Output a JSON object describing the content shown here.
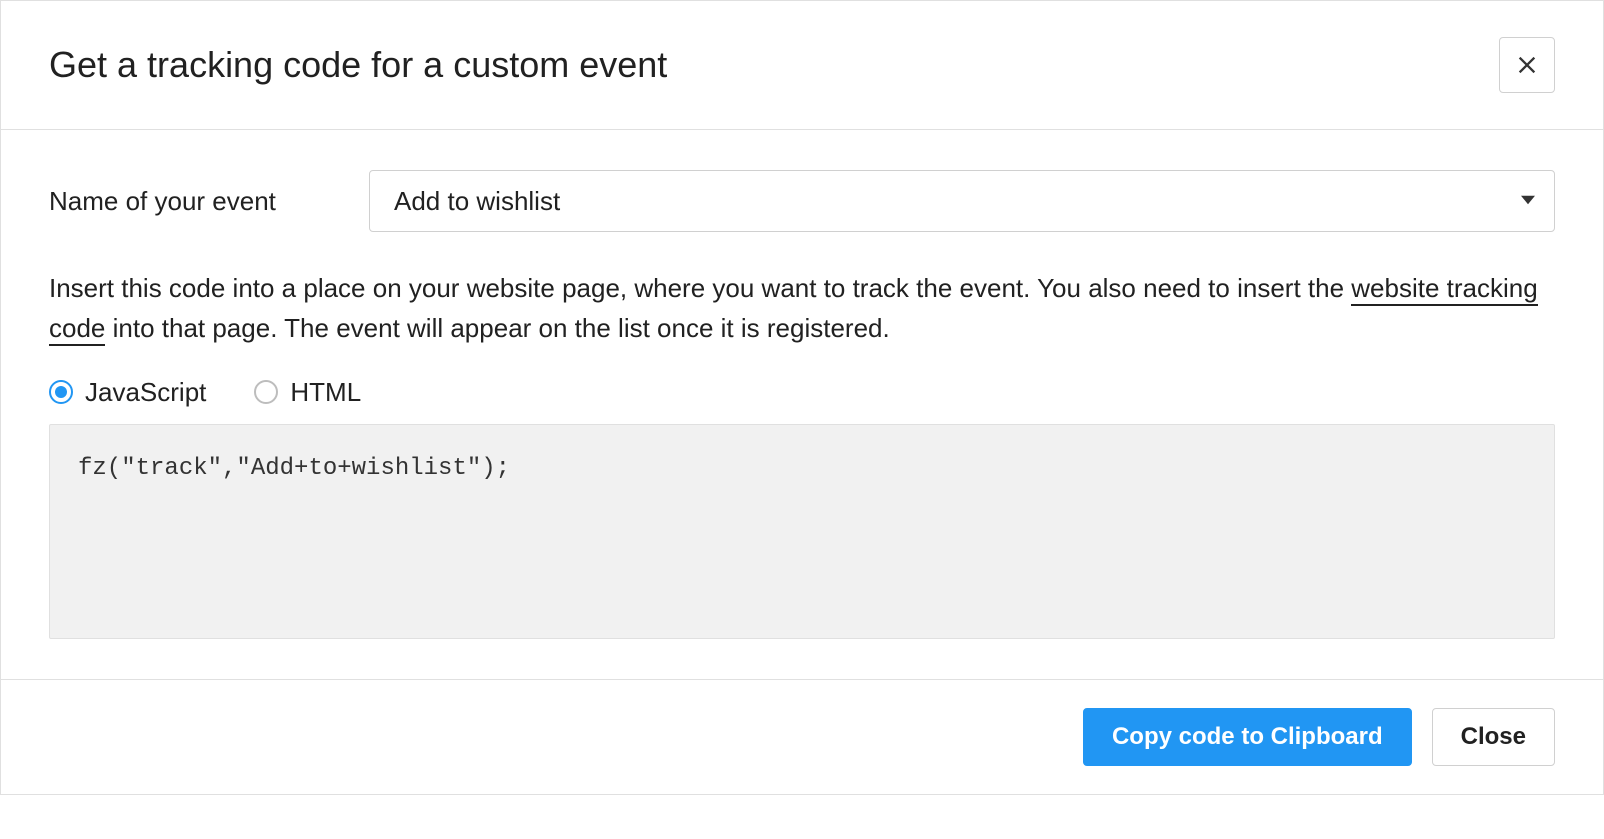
{
  "header": {
    "title": "Get a tracking code for a custom event"
  },
  "form": {
    "event_name_label": "Name of your event",
    "event_name_value": "Add to wishlist"
  },
  "instruction": {
    "pre_link": "Insert this code into a place on your website page, where you want to track the event. You also need to insert the ",
    "link_text": "website tracking code",
    "post_link": " into that page. The event will appear on the list once it is registered."
  },
  "code_type": {
    "options": [
      {
        "label": "JavaScript",
        "checked": true
      },
      {
        "label": "HTML",
        "checked": false
      }
    ]
  },
  "code_snippet": "fz(\"track\",\"Add+to+wishlist\");",
  "footer": {
    "copy_label": "Copy code to Clipboard",
    "close_label": "Close"
  }
}
